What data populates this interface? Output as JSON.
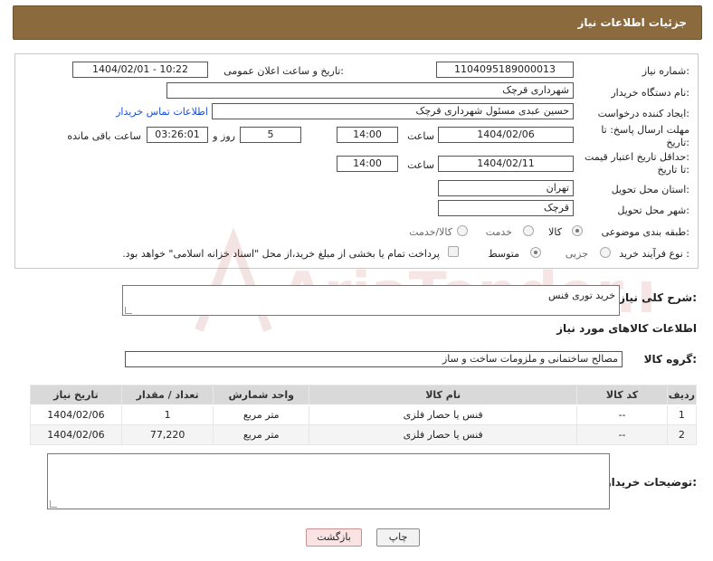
{
  "header": {
    "title": "جزئیات اطلاعات نیاز"
  },
  "form": {
    "need_number_label": "شماره نیاز:",
    "need_number": "1104095189000013",
    "announce_label": "تاریخ و ساعت اعلان عمومی:",
    "announce_value": "1404/02/01 - 10:22",
    "buyer_org_label": "نام دستگاه خریدار:",
    "buyer_org": "شهرداری قرچک",
    "creator_label": "ایجاد کننده درخواست:",
    "creator": "حسین عبدی مسئول شهرداری قرچک",
    "contact_link": "اطلاعات تماس خریدار",
    "deadline_label_1": "مهلت ارسال پاسخ: تا",
    "deadline_label_2": "تاریخ:",
    "deadline_date": "1404/02/06",
    "time_label": "ساعت",
    "deadline_time": "14:00",
    "days_value": "5",
    "days_label": "روز و",
    "remaining_time": "03:26:01",
    "remaining_label": "ساعت باقی مانده",
    "validity_label_1": "حداقل تاریخ اعتبار قیمت:",
    "validity_label_2": "تا تاریخ:",
    "validity_date": "1404/02/11",
    "validity_time_label": "ساعت",
    "validity_time": "14:00",
    "province_label": "استان محل تحویل:",
    "province": "تهران",
    "city_label": "شهر محل تحویل:",
    "city": "قرچک",
    "category_label": "طبقه بندی موضوعی:",
    "category_options": [
      "کالا",
      "خدمت",
      "کالا/خدمت"
    ],
    "category_selected": "کالا",
    "process_label": "نوع فرآیند خرید :",
    "process_options": [
      "جزیی",
      "متوسط"
    ],
    "process_selected": "متوسط",
    "payment_note": "پرداخت تمام یا بخشی از مبلغ خرید،از محل \"اسناد خزانه اسلامی\" خواهد بود."
  },
  "description": {
    "label": "شرح کلی نیاز:",
    "value": "خرید توری فنس"
  },
  "goods": {
    "section_title": "اطلاعات کالاهای مورد نیاز",
    "group_label": "گروه کالا:",
    "group_value": "مصالح ساختمانی و ملزومات ساخت و ساز",
    "columns": [
      "ردیف",
      "کد کالا",
      "نام کالا",
      "واحد شمارش",
      "تعداد / مقدار",
      "تاریخ نیاز"
    ],
    "rows": [
      [
        "1",
        "--",
        "فنس یا حصار فلزی",
        "متر مربع",
        "1",
        "1404/02/06"
      ],
      [
        "2",
        "--",
        "فنس یا حصار فلزی",
        "متر مربع",
        "77,220",
        "1404/02/06"
      ]
    ]
  },
  "buyer_notes": {
    "label": "توضیحات خریدار:",
    "value": ""
  },
  "buttons": {
    "print": "چاپ",
    "back": "بازگشت"
  },
  "watermark": {
    "text": "AriaTender.neT"
  },
  "colors": {
    "header_bg": "#8b6a3e",
    "link": "#1a4fd6",
    "back_button_bg": "#fbe3e3"
  }
}
